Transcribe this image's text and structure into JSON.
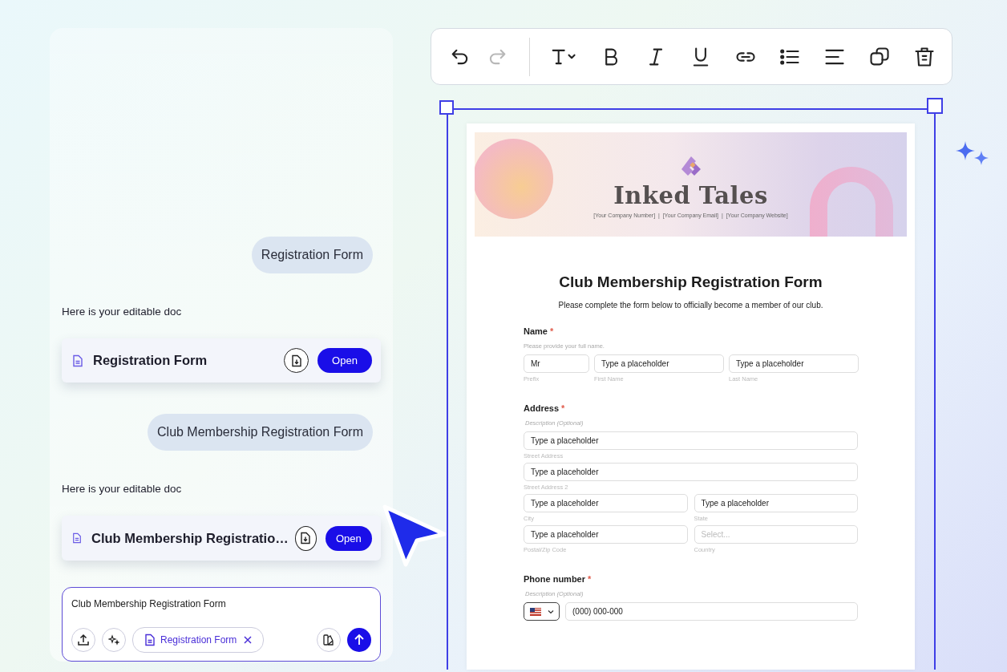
{
  "chat": {
    "messages": [
      {
        "kind": "user",
        "text": "Registration Form"
      },
      {
        "kind": "bot",
        "text": "Here is your editable doc"
      },
      {
        "kind": "doc",
        "title": "Registration Form",
        "action": "Open"
      },
      {
        "kind": "user",
        "text": "Club Membership Registration Form"
      },
      {
        "kind": "bot",
        "text": "Here is your editable doc"
      },
      {
        "kind": "doc",
        "title": "Club Membership Registratio…",
        "action": "Open"
      }
    ],
    "composer": {
      "value": "Club Membership Registration Form",
      "attachment": "Registration Form"
    }
  },
  "toolbar": {
    "history": [
      {
        "kind": "undo",
        "disabled": false
      },
      {
        "kind": "redo",
        "disabled": true
      }
    ],
    "format": [
      {
        "kind": "text-style"
      },
      {
        "kind": "bold"
      },
      {
        "kind": "italic"
      },
      {
        "kind": "underline"
      },
      {
        "kind": "link"
      },
      {
        "kind": "bullets"
      },
      {
        "kind": "align"
      },
      {
        "kind": "duplicate"
      },
      {
        "kind": "delete"
      }
    ]
  },
  "document": {
    "brand": "Inked Tales",
    "contacts": "[Your Company Number]  |  [Your Company Email]  |  [Your Company Website]",
    "title": "Club Membership Registration Form",
    "intro": "Please complete the form below to officially become a member of our club.",
    "sections": [
      {
        "label": "Name",
        "required": true,
        "required_mark": "*",
        "description": {
          "kind": "custom",
          "text": "Please provide your full name."
        },
        "rows": [
          {
            "kind": "name",
            "fields": [
              {
                "kind": "text",
                "value": "Mr",
                "caption": "Prefix"
              },
              {
                "kind": "text",
                "value": "Type a placeholder",
                "caption": "First Name"
              },
              {
                "kind": "text",
                "value": "Type a placeholder",
                "caption": "Last Name"
              }
            ]
          }
        ]
      },
      {
        "label": "Address",
        "required": true,
        "required_mark": "*",
        "description": {
          "kind": "placeholder",
          "text": "Description (Optional)"
        },
        "rows": [
          {
            "kind": "full",
            "fields": [
              {
                "kind": "text",
                "value": "Type a placeholder",
                "caption": "Street Address"
              }
            ]
          },
          {
            "kind": "full",
            "fields": [
              {
                "kind": "text",
                "value": "Type a placeholder",
                "caption": "Street Address 2"
              }
            ]
          },
          {
            "kind": "half",
            "fields": [
              {
                "kind": "text",
                "value": "Type a placeholder",
                "caption": "City"
              },
              {
                "kind": "text",
                "value": "Type a placeholder",
                "caption": "State"
              }
            ]
          },
          {
            "kind": "half",
            "fields": [
              {
                "kind": "text",
                "value": "Type a placeholder",
                "caption": "Postal/Zip Code"
              },
              {
                "kind": "select",
                "placeholder": "Select...",
                "caption": "Country"
              }
            ]
          }
        ]
      },
      {
        "label": "Phone number",
        "required": true,
        "required_mark": "*",
        "description": {
          "kind": "placeholder",
          "text": "Description (Optional)"
        },
        "rows": [
          {
            "kind": "phone",
            "fields": [
              {
                "kind": "country"
              },
              {
                "kind": "text",
                "value": "(000) 000-000"
              }
            ]
          }
        ]
      }
    ]
  }
}
